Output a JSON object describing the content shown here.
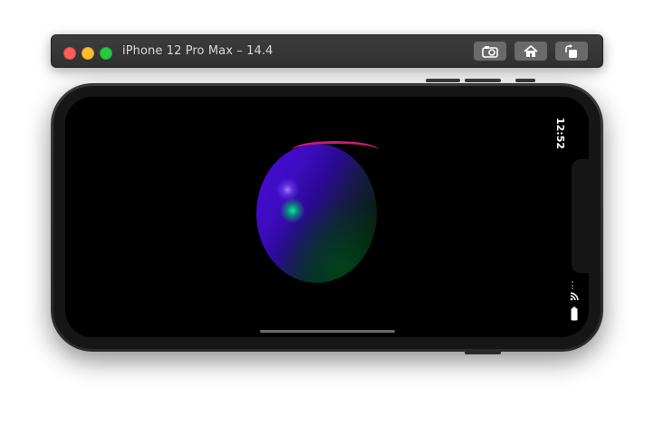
{
  "window": {
    "title": "iPhone 12 Pro Max – 14.4",
    "buttons": {
      "screenshot": "camera-icon",
      "home": "home-icon",
      "rotate": "rotate-icon"
    }
  },
  "status_bar": {
    "time": "12:52",
    "icons": [
      "wifi-icon",
      "battery-icon"
    ]
  },
  "colors": {
    "close": "#ff5f57",
    "minimize": "#febc2e",
    "maximize": "#28c840",
    "sphere_primary": "#4a0bd6",
    "sphere_highlight": "#00ff8c",
    "sphere_rim": "#d01a70"
  }
}
